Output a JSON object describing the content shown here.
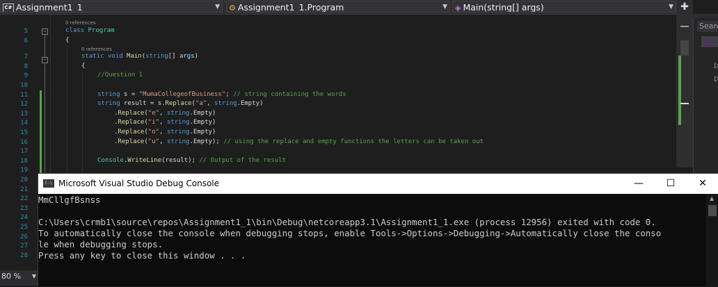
{
  "navbar": {
    "project": "Assignment1_1",
    "class_path": "Assignment1_1.Program",
    "member": "Main(string[] args)",
    "project_icon": "C#"
  },
  "right_panel": {
    "search_placeholder": "Searc"
  },
  "editor": {
    "references": [
      "0 references",
      "0 references"
    ],
    "lines": [
      {
        "n": "5",
        "tokens": [
          {
            "t": "class",
            "c": "kw"
          },
          {
            "t": " "
          },
          {
            "t": "Program",
            "c": "ty"
          }
        ]
      },
      {
        "n": "6",
        "tokens": [
          {
            "t": "{"
          }
        ]
      },
      {
        "n": "7",
        "tokens": [
          {
            "t": "static",
            "c": "kw"
          },
          {
            "t": " "
          },
          {
            "t": "void",
            "c": "kw"
          },
          {
            "t": " "
          },
          {
            "t": "Main",
            "c": "fn"
          },
          {
            "t": "("
          },
          {
            "t": "string",
            "c": "kw"
          },
          {
            "t": "[] "
          },
          {
            "t": "args",
            "c": "pm"
          },
          {
            "t": ")"
          }
        ]
      },
      {
        "n": "8",
        "tokens": [
          {
            "t": "{"
          }
        ]
      },
      {
        "n": "9",
        "tokens": [
          {
            "t": "//Question 1",
            "c": "cm"
          }
        ]
      },
      {
        "n": "10",
        "tokens": []
      },
      {
        "n": "11",
        "tokens": [
          {
            "t": "string",
            "c": "kw"
          },
          {
            "t": " s = "
          },
          {
            "t": "\"MumaCollegeofBusiness\"",
            "c": "st"
          },
          {
            "t": "; "
          },
          {
            "t": "// string containing the words",
            "c": "cm"
          }
        ]
      },
      {
        "n": "12",
        "tokens": [
          {
            "t": "string",
            "c": "kw"
          },
          {
            "t": " result = s."
          },
          {
            "t": "Replace",
            "c": "fn"
          },
          {
            "t": "("
          },
          {
            "t": "\"a\"",
            "c": "st"
          },
          {
            "t": ", "
          },
          {
            "t": "string",
            "c": "kw"
          },
          {
            "t": ".Empty)"
          }
        ]
      },
      {
        "n": "13",
        "tokens": [
          {
            "t": "."
          },
          {
            "t": "Replace",
            "c": "fn"
          },
          {
            "t": "("
          },
          {
            "t": "\"e\"",
            "c": "st"
          },
          {
            "t": ", "
          },
          {
            "t": "string",
            "c": "kw"
          },
          {
            "t": ".Empty)"
          }
        ]
      },
      {
        "n": "14",
        "tokens": [
          {
            "t": "."
          },
          {
            "t": "Replace",
            "c": "fn"
          },
          {
            "t": "("
          },
          {
            "t": "\"i\"",
            "c": "st"
          },
          {
            "t": ", "
          },
          {
            "t": "string",
            "c": "kw"
          },
          {
            "t": ".Empty)"
          }
        ]
      },
      {
        "n": "15",
        "tokens": [
          {
            "t": "."
          },
          {
            "t": "Replace",
            "c": "fn"
          },
          {
            "t": "("
          },
          {
            "t": "\"o\"",
            "c": "st"
          },
          {
            "t": ", "
          },
          {
            "t": "string",
            "c": "kw"
          },
          {
            "t": ".Empty)"
          }
        ]
      },
      {
        "n": "16",
        "tokens": [
          {
            "t": "."
          },
          {
            "t": "Replace",
            "c": "fn"
          },
          {
            "t": "("
          },
          {
            "t": "\"u\"",
            "c": "st"
          },
          {
            "t": ", "
          },
          {
            "t": "string",
            "c": "kw"
          },
          {
            "t": ".Empty); "
          },
          {
            "t": "// using the replace and empty functions the letters can be taken out",
            "c": "cm"
          }
        ]
      },
      {
        "n": "17",
        "tokens": []
      },
      {
        "n": "18",
        "tokens": [
          {
            "t": "Console",
            "c": "ty"
          },
          {
            "t": "."
          },
          {
            "t": "WriteLine",
            "c": "fn"
          },
          {
            "t": "(result); "
          },
          {
            "t": "// Output of the result",
            "c": "cm"
          }
        ]
      },
      {
        "n": "19",
        "tokens": []
      },
      {
        "n": "20",
        "tokens": []
      },
      {
        "n": "21",
        "tokens": []
      },
      {
        "n": "22",
        "tokens": []
      },
      {
        "n": "23",
        "tokens": []
      },
      {
        "n": "24",
        "tokens": []
      },
      {
        "n": "25",
        "tokens": []
      },
      {
        "n": "26",
        "tokens": []
      },
      {
        "n": "27",
        "tokens": []
      },
      {
        "n": "28",
        "tokens": []
      }
    ]
  },
  "status": {
    "zoom": "80 %"
  },
  "console": {
    "icon_text": "C:\\",
    "title": "Microsoft Visual Studio Debug Console",
    "lines": [
      "MmCllgfBsnss",
      "",
      "C:\\Users\\crmb1\\source\\repos\\Assignment1_1\\bin\\Debug\\netcoreapp3.1\\Assignment1_1.exe (process 12956) exited with code 0.",
      "To automatically close the console when debugging stops, enable Tools->Options->Debugging->Automatically close the conso",
      "le when debugging stops.",
      "Press any key to close this window . . ."
    ]
  },
  "colors": {
    "keyword": "#569cd6",
    "type": "#4ec9b0",
    "string": "#d69d85",
    "comment": "#57a64a",
    "line_number": "#2b91af"
  }
}
